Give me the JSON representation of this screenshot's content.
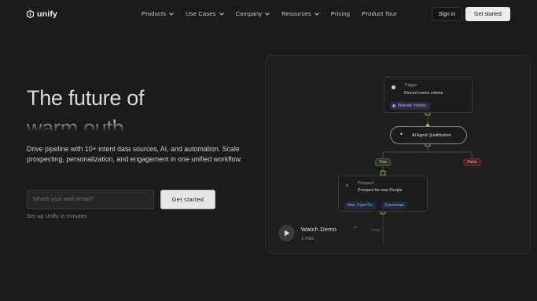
{
  "brand": {
    "name": "unify"
  },
  "nav": {
    "links": [
      {
        "label": "Products",
        "has_dropdown": true
      },
      {
        "label": "Use Cases",
        "has_dropdown": true
      },
      {
        "label": "Company",
        "has_dropdown": true
      },
      {
        "label": "Resources",
        "has_dropdown": true
      },
      {
        "label": "Pricing",
        "has_dropdown": false
      },
      {
        "label": "Product Tour",
        "has_dropdown": false
      }
    ],
    "signin_label": "Sign in",
    "cta_label": "Get started"
  },
  "hero": {
    "title_line1": "The future of",
    "title_line2": "warm outb",
    "description": "Drive pipeline with 10+ intent data sources, AI, and automation. Scale prospecting, personalization, and engagement in one unified workflow.",
    "email_placeholder": "What's your work email?",
    "cta_label": "Get started",
    "note": "Set up Unify in minutes"
  },
  "flow": {
    "trigger": {
      "label": "Trigger",
      "subtitle": "Record meets criteria",
      "pill": "Website Visitors"
    },
    "ai_node": {
      "label": "AI Agent Qualification"
    },
    "branch_true": "True",
    "branch_false": "False",
    "prospect": {
      "label": "Prospect",
      "subtitle": "Prospect for new People",
      "pill1": "Max. 3 per Co.",
      "pill2": "3 personas"
    },
    "next_node_label": "Loop"
  },
  "demo": {
    "title": "Watch Demo",
    "duration": "1 min"
  },
  "colors": {
    "background": "#1b1b1b",
    "accent_purple": "#9e8ef0",
    "true_green": "#b5d88a",
    "false_red": "#f0a0a0",
    "connector_green": "#a8c860"
  }
}
